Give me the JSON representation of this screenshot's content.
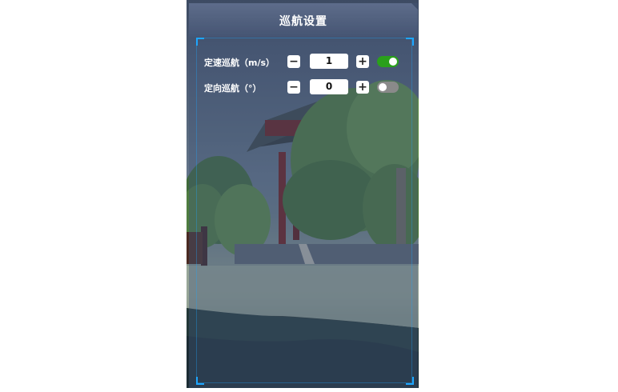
{
  "panel": {
    "title": "巡航设置"
  },
  "rows": [
    {
      "label": "定速巡航（m/s）",
      "minus_label": "−",
      "value": "1",
      "plus_label": "+",
      "enabled": true
    },
    {
      "label": "定向巡航（°）",
      "minus_label": "−",
      "value": "0",
      "plus_label": "+",
      "enabled": false
    }
  ],
  "colors": {
    "accent": "#1ea6ff",
    "toggle_on": "#2aa01b",
    "toggle_off": "#8a8a8a"
  }
}
